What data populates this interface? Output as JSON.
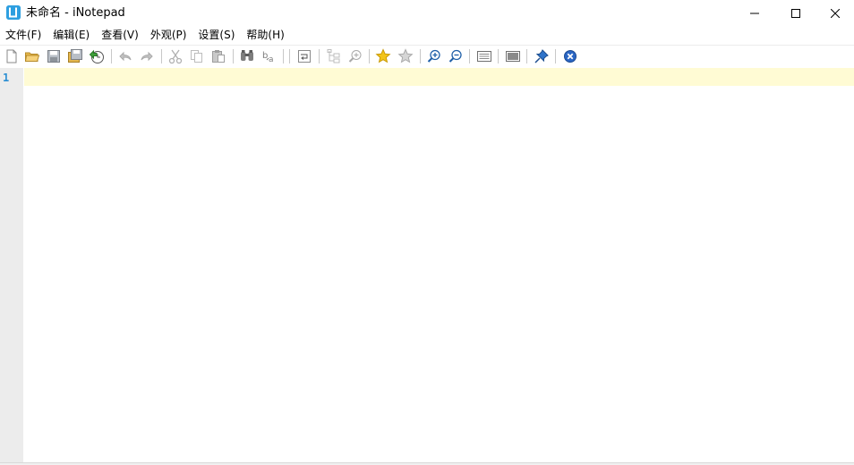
{
  "window": {
    "title": "未命名 - iNotepad"
  },
  "title_bar_buttons": {
    "minimize": "minimize-icon",
    "maximize": "maximize-icon",
    "close": "close-icon"
  },
  "menu": [
    "文件(F)",
    "编辑(E)",
    "查看(V)",
    "外观(P)",
    "设置(S)",
    "帮助(H)"
  ],
  "toolbar": {
    "icons": [
      "new-file-icon",
      "open-folder-icon",
      "save-icon",
      "save-all-icon",
      "revert-icon",
      "undo-icon",
      "redo-icon",
      "cut-icon",
      "copy-icon",
      "paste-icon",
      "find-icon",
      "replace-icon",
      "word-wrap-icon",
      "tree-view-icon",
      "zoom-view-icon",
      "bookmark-star-icon",
      "bookmark-remove-icon",
      "zoom-in-icon",
      "zoom-out-icon",
      "keyboard-icon",
      "fullscreen-icon",
      "pin-icon",
      "close-doc-icon"
    ]
  },
  "editor": {
    "line_numbers": [
      "1"
    ],
    "content": "",
    "current_line_color": "#fffbd4",
    "line_number_color": "#2b8fd3"
  },
  "colors": {
    "app_icon": "#2e9fe0",
    "gutter": "#ececec"
  }
}
